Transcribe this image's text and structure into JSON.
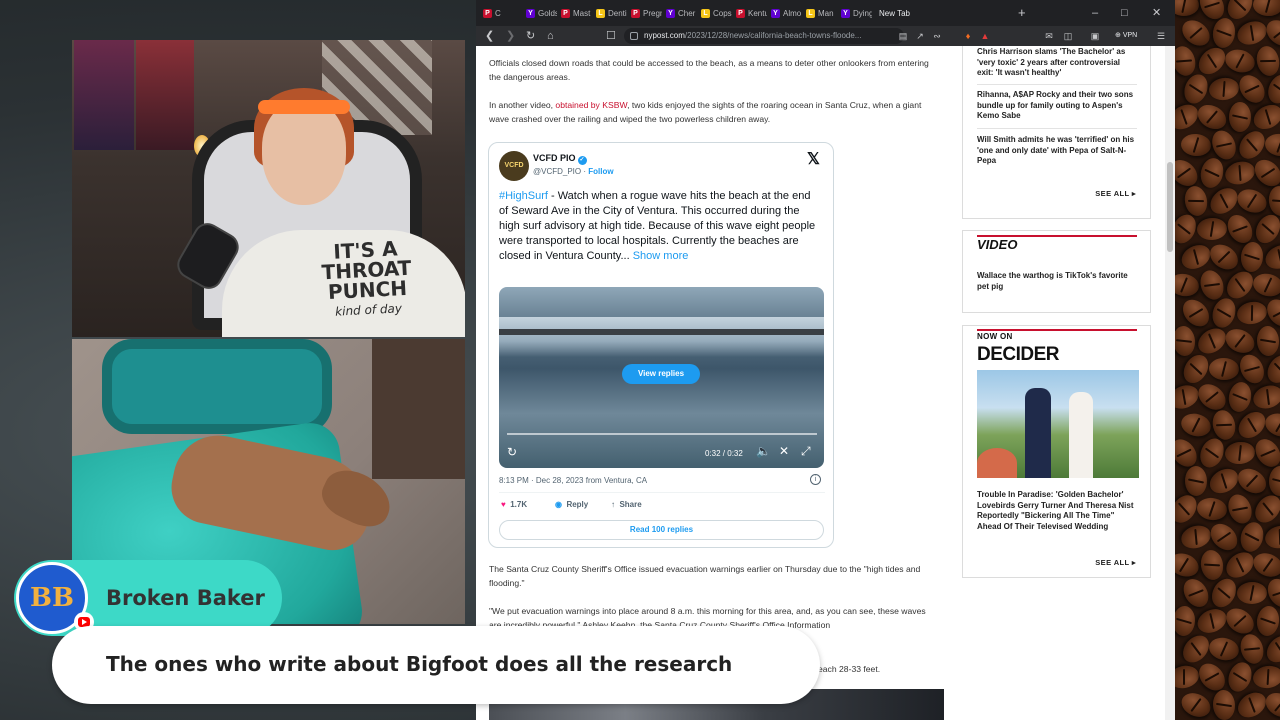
{
  "browser": {
    "tabs": [
      {
        "label": "C",
        "icon": "nypost-icon",
        "color": "#c8102e"
      },
      {
        "label": "Golds",
        "icon": "yahoo-icon",
        "color": "#6001d2"
      },
      {
        "label": "Mast",
        "icon": "nypost-icon",
        "color": "#c8102e"
      },
      {
        "label": "Denti",
        "icon": "ladbible-icon",
        "color": "#f5c518"
      },
      {
        "label": "Pregn",
        "icon": "nypost-icon",
        "color": "#c8102e"
      },
      {
        "label": "Cher",
        "icon": "yahoo-icon",
        "color": "#6001d2"
      },
      {
        "label": "Cops",
        "icon": "ladbible-icon",
        "color": "#f5c518"
      },
      {
        "label": "Kentu",
        "icon": "nypost-icon",
        "color": "#c8102e"
      },
      {
        "label": "Almo",
        "icon": "yahoo-icon",
        "color": "#6001d2"
      },
      {
        "label": "Man",
        "icon": "ladbible-icon",
        "color": "#f5c518"
      },
      {
        "label": "Dying",
        "icon": "yahoo-icon",
        "color": "#6001d2"
      },
      {
        "label": "New Tab",
        "icon": "",
        "color": ""
      }
    ],
    "new_tab_glyph": "+",
    "url_domain": "nypost.com",
    "url_path": "/2023/12/28/news/california-beach-towns-floode...",
    "vpn_label": "VPN"
  },
  "article": {
    "para1": "Officials closed down roads that could be accessed to the beach, as a means to deter other onlookers from entering the dangerous areas.",
    "para2_pre": "In another video, ",
    "para2_link": "obtained by KSBW",
    "para2_post": ", two kids enjoyed the sights of the roaring ocean in Santa Cruz, when a giant wave crashed over the railing and wiped the two powerless children away.",
    "para3": "The Santa Cruz County Sheriff's Office issued evacuation warnings earlier on Thursday due to the \"high tides and flooding.\"",
    "para4": "\"We put evacuation warnings into place around 8 a.m. this morning for this area, and, as you can see, these waves are incredibly powerful,\" Ashley Keehn, the Santa Cruz County Sheriff's Office Information",
    "para5_visible": "each 28-33 feet."
  },
  "tweet": {
    "avatar_text": "VCFD",
    "name": "VCFD PIO",
    "handle": "@VCFD_PIO",
    "follow": "Follow",
    "hashtag": "#HighSurf",
    "body": " - Watch when a rogue wave hits the beach at the end of Seward Ave in the City of Ventura. This occurred during the high surf advisory at high tide. Because of this wave eight people were transported to local hospitals. Currently the beaches are closed in Ventura County... ",
    "show_more": "Show more",
    "view_replies": "View replies",
    "video_time": "0:32 / 0:32",
    "meta": "8:13 PM · Dec 28, 2023 from Ventura, CA",
    "likes": "1.7K",
    "reply": "Reply",
    "share": "Share",
    "read_replies": "Read 100 replies"
  },
  "sidebar": {
    "headlines": [
      "Chris Harrison slams 'The Bachelor' as 'very toxic' 2 years after controversial exit: 'It wasn't healthy'",
      "Rihanna, A$AP Rocky and their two sons bundle up for family outing to Aspen's Kemo Sabe",
      "Will Smith admits he was 'terrified' on his 'one and only date' with Pepa of Salt-N-Pepa"
    ],
    "see_all": "SEE ALL",
    "video_label": "VIDEO",
    "video_headline": "Wallace the warthog is TikTok's favorite pet pig",
    "now_on": "NOW ON",
    "decider": "DECIDER",
    "decider_headline": "Trouble In Paradise: 'Golden Bachelor' Lovebirds Gerry Turner And Theresa Nist Reportedly \"Bickering All The Time\" Ahead Of Their Televised Wedding",
    "see_all_2": "SEE ALL"
  },
  "overlay": {
    "streamer_name": "Broken Baker",
    "avatar_initials": "BB",
    "caption": "The ones who write about Bigfoot does all the research",
    "hoodie_text": "IT'S A THROAT PUNCH",
    "hoodie_subtext": "kind of day"
  }
}
